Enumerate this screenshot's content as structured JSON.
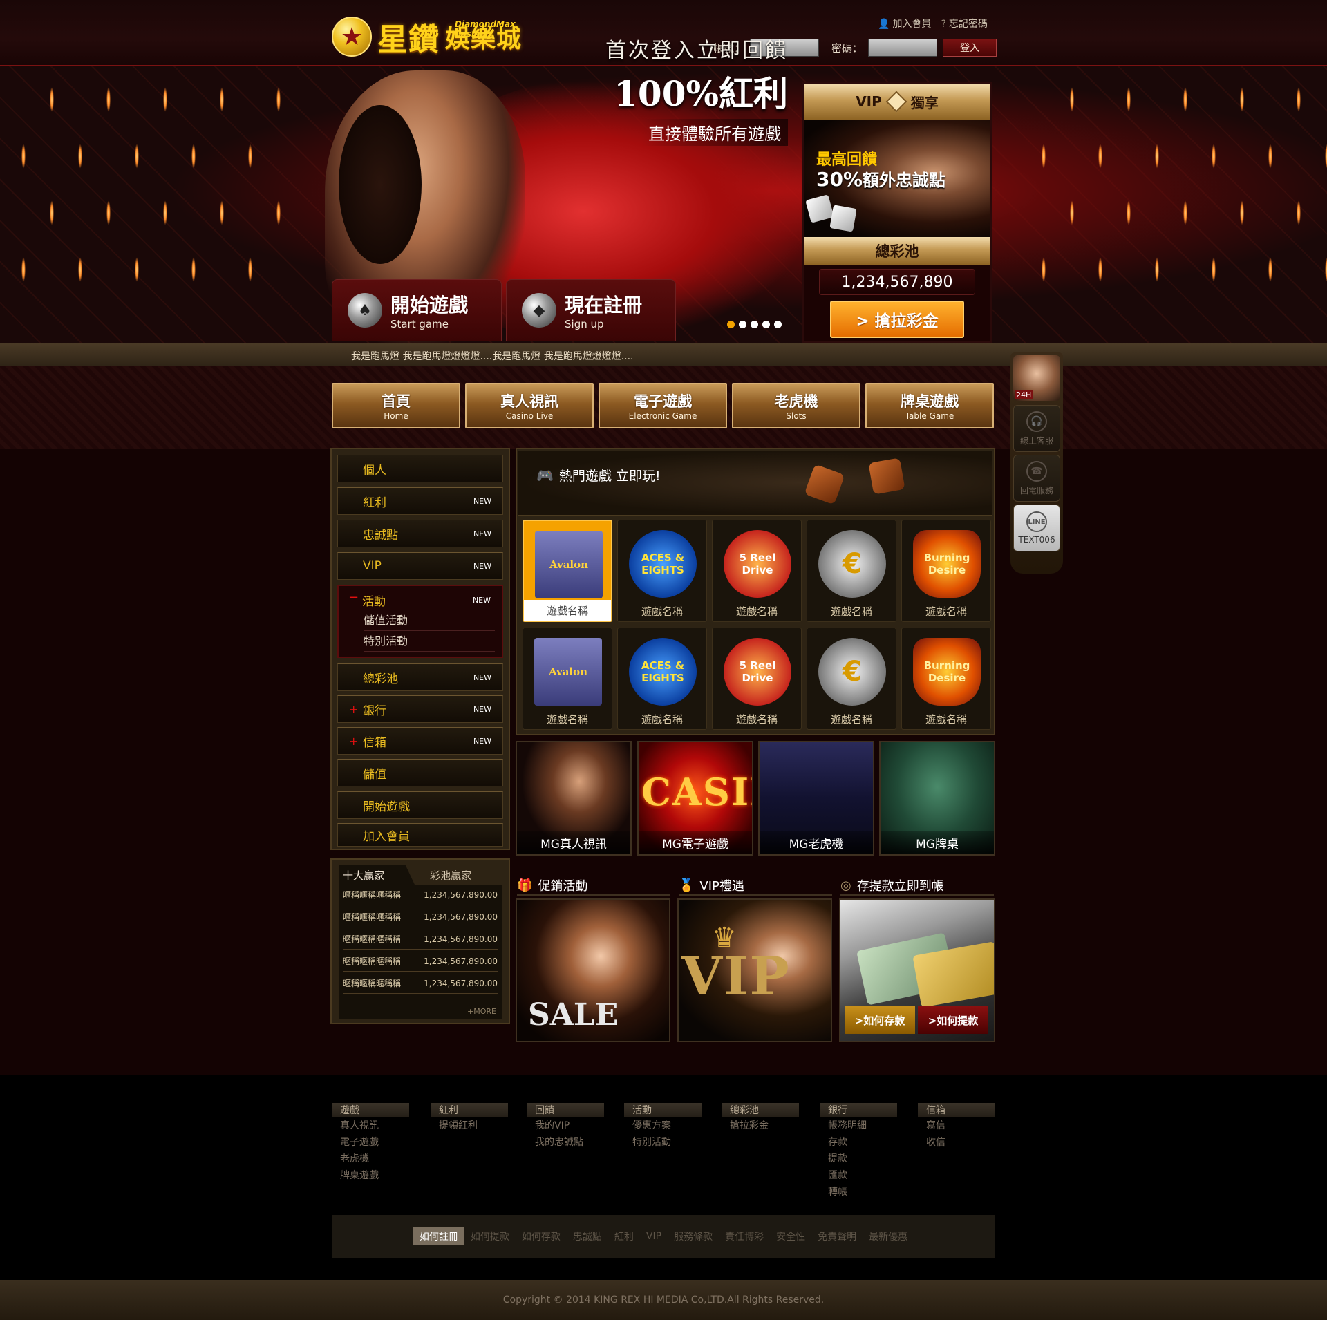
{
  "header": {
    "logo_zh": "星鑽",
    "logo_zh2": "娛樂城",
    "logo_en": "DiamondMax Casino",
    "join_link": "加入會員",
    "forgot_link": "忘記密碼",
    "account_label": "帳號：",
    "password_label": "密碼：",
    "login_button": "登入"
  },
  "hero": {
    "line1": "首次登入立即回饋",
    "line2": "100%紅利",
    "line3": "直接體驗所有遊戲",
    "start_zh": "開始遊戲",
    "start_en": "Start game",
    "signup_zh": "現在註冊",
    "signup_en": "Sign up",
    "slides_total": 5,
    "slide_active": 1
  },
  "vip_box": {
    "head_left": "VIP",
    "head_right": "獨享",
    "line1": "最高回饋",
    "line2_big": "30%",
    "line2_rest": "額外忠誠點",
    "jackpot_title": "總彩池",
    "jackpot_value": "1,234,567,890",
    "jackpot_button": "> 搶拉彩金"
  },
  "marquee": "我是跑馬燈 我是跑馬燈燈燈燈....我是跑馬燈 我是跑馬燈燈燈燈....",
  "nav": [
    {
      "zh": "首頁",
      "en": "Home"
    },
    {
      "zh": "真人視訊",
      "en": "Casino Live"
    },
    {
      "zh": "電子遊戲",
      "en": "Electronic Game"
    },
    {
      "zh": "老虎機",
      "en": "Slots"
    },
    {
      "zh": "牌桌遊戲",
      "en": "Table Game"
    }
  ],
  "service": {
    "agent_badge": "24H",
    "online": "線上客服",
    "callback": "回電服務",
    "line_logo": "LINE",
    "line_id": "TEXT006"
  },
  "sidebar": {
    "new_tag": "NEW",
    "items": [
      {
        "label": "個人"
      },
      {
        "label": "紅利"
      },
      {
        "label": "忠誠點"
      },
      {
        "label": "VIP"
      },
      {
        "label": "活動"
      },
      {
        "label": "總彩池"
      },
      {
        "label": "銀行"
      },
      {
        "label": "信箱"
      },
      {
        "label": "儲值"
      },
      {
        "label": "開始遊戲"
      },
      {
        "label": "加入會員"
      }
    ],
    "activity_sub": [
      "儲值活動",
      "特別活動"
    ]
  },
  "winners": {
    "tab1": "十大贏家",
    "tab2": "彩池贏家",
    "rows": [
      {
        "name": "暱稱暱稱暱稱稱",
        "amount": "1,234,567,890.00"
      },
      {
        "name": "暱稱暱稱暱稱稱",
        "amount": "1,234,567,890.00"
      },
      {
        "name": "暱稱暱稱暱稱稱",
        "amount": "1,234,567,890.00"
      },
      {
        "name": "暱稱暱稱暱稱稱",
        "amount": "1,234,567,890.00"
      },
      {
        "name": "暱稱暱稱暱稱稱",
        "amount": "1,234,567,890.00"
      }
    ],
    "more": "+MORE"
  },
  "hot_games": {
    "title": "熱門遊戲 立即玩!",
    "games": [
      {
        "art": "Avalon",
        "name": "遊戲名稱"
      },
      {
        "art": "ACES & EIGHTS",
        "name": "遊戲名稱"
      },
      {
        "art": "5 Reel Drive",
        "name": "遊戲名稱"
      },
      {
        "art": "€",
        "name": "遊戲名稱"
      },
      {
        "art": "Burning Desire",
        "name": "遊戲名稱"
      },
      {
        "art": "Avalon",
        "name": "遊戲名稱"
      },
      {
        "art": "ACES & EIGHTS",
        "name": "遊戲名稱"
      },
      {
        "art": "5 Reel Drive",
        "name": "遊戲名稱"
      },
      {
        "art": "€",
        "name": "遊戲名稱"
      },
      {
        "art": "Burning Desire",
        "name": "遊戲名稱"
      }
    ]
  },
  "categories": {
    "live": "MG真人視訊",
    "elec": "MG電子遊戲",
    "elec_art": "CASINO",
    "slot": "MG老虎機",
    "table": "MG牌桌"
  },
  "promo": {
    "sale_head": "促銷活動",
    "sale_art": "SALE",
    "vip_head": "VIP禮遇",
    "vip_art": "VIP",
    "bank_head": "存提款立即到帳",
    "deposit_btn": ">如何存款",
    "withdraw_btn": ">如何提款"
  },
  "footer": {
    "cols": [
      {
        "head": "遊戲",
        "items": [
          "真人視訊",
          "電子遊戲",
          "老虎機",
          "牌桌遊戲"
        ]
      },
      {
        "head": "紅利",
        "items": [
          "提領紅利"
        ]
      },
      {
        "head": "回饋",
        "items": [
          "我的VIP",
          "我的忠誠點"
        ]
      },
      {
        "head": "活動",
        "items": [
          "優惠方案",
          "特別活動"
        ]
      },
      {
        "head": "總彩池",
        "items": [
          "搶拉彩金"
        ]
      },
      {
        "head": "銀行",
        "items": [
          "帳務明細",
          "存款",
          "提款",
          "匯款",
          "轉帳"
        ]
      },
      {
        "head": "信箱",
        "items": [
          "寫信",
          "收信"
        ]
      }
    ],
    "links": [
      "如何註冊",
      "如何提款",
      "如何存款",
      "忠誠點",
      "紅利",
      "VIP",
      "服務條款",
      "責任博彩",
      "安全性",
      "免責聲明",
      "最新優惠"
    ],
    "copyright": "Copyright © 2014 KING REX HI MEDIA Co,LTD.All Rights Reserved."
  },
  "colors": {
    "gold": "#e8ba20",
    "accent_orange": "#f5a200",
    "deep_red": "#7a1212"
  }
}
